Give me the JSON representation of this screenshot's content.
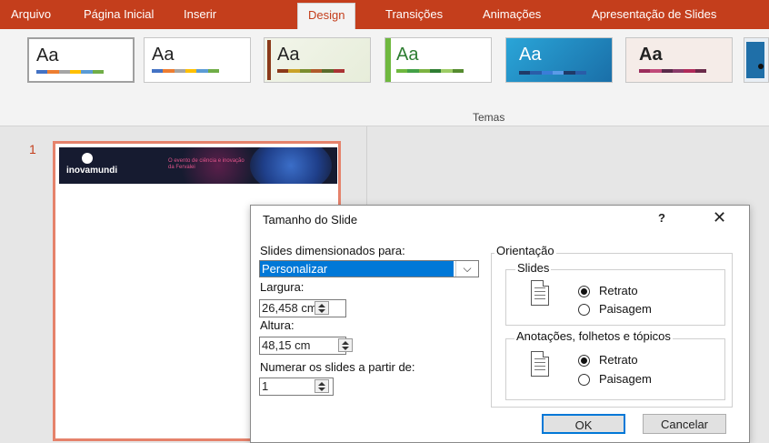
{
  "ribbon": {
    "tabs": [
      "Arquivo",
      "Página Inicial",
      "Inserir",
      "Design",
      "Transições",
      "Animações",
      "Apresentação de Slides"
    ],
    "active_tab": "Design",
    "group_label": "Temas",
    "accent_color": "#c43e1c",
    "themes": [
      {
        "label": "Aa",
        "bg": "#ffffff",
        "colors": [
          "#4472c4",
          "#ed7d31",
          "#a5a5a5",
          "#ffc000",
          "#5b9bd5",
          "#70ad47"
        ]
      },
      {
        "label": "Aa",
        "bg": "#ffffff",
        "colors": [
          "#4472c4",
          "#ed7d31",
          "#a5a5a5",
          "#ffc000",
          "#5b9bd5",
          "#70ad47"
        ]
      },
      {
        "label": "Aa",
        "bg": "#eef2e6",
        "colors": [
          "#8b3a1a",
          "#c9a227",
          "#7a8c2e",
          "#b05a2a",
          "#5a6b2a",
          "#a33"
        ]
      },
      {
        "label": "Aa",
        "bg": "#ffffff",
        "colors": [
          "#6fb83f",
          "#43a047",
          "#7cb342",
          "#2e7d32",
          "#9ccc65",
          "#558b2f"
        ]
      },
      {
        "label": "Aa",
        "bg": "#1f8fbf",
        "colors": [
          "#1f3a68",
          "#2a5da8",
          "#3b7dd8",
          "#5a9be8",
          "#1f3a68",
          "#2a5da8"
        ]
      },
      {
        "label": "Aa",
        "bg": "#f5ece8",
        "colors": [
          "#9b2d5c",
          "#c04a7a",
          "#5a2a4a",
          "#8a3a6a",
          "#b02a5a",
          "#6a2a4a"
        ]
      }
    ]
  },
  "slides": {
    "number": "1",
    "banner_logo": "inovamundi",
    "banner_tagline": "O evento de ciência e inovação da Fervalei"
  },
  "dialog": {
    "title": "Tamanho do Slide",
    "help": "?",
    "close": "✕",
    "size_label": "Slides dimensionados para:",
    "size_value": "Personalizar",
    "dropdown_arrow": "⌵",
    "width_label": "Largura:",
    "width_value": "26,458 cm",
    "height_label": "Altura:",
    "height_value": "48,15 cm",
    "number_label": "Numerar os slides a partir de:",
    "number_value": "1",
    "orientation_label": "Orientação",
    "slides_group_label": "Slides",
    "slides_portrait": "Retrato",
    "slides_landscape": "Paisagem",
    "notes_group_label": "Anotações, folhetos e tópicos",
    "notes_portrait": "Retrato",
    "notes_landscape": "Paisagem",
    "ok_label": "OK",
    "cancel_label": "Cancelar"
  }
}
